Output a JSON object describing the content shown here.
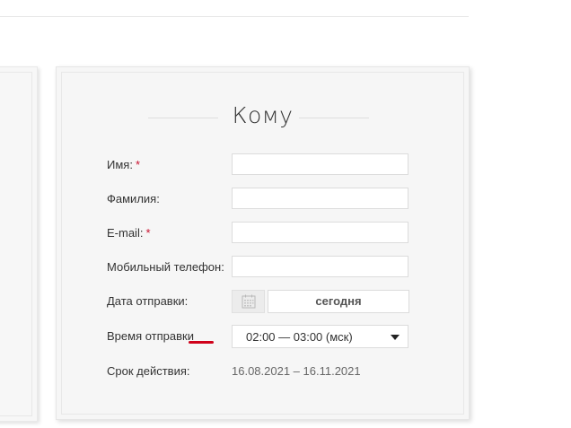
{
  "form": {
    "title": "Кому",
    "fields": {
      "first_name": {
        "label": "Имя:",
        "required_mark": "*",
        "value": ""
      },
      "last_name": {
        "label": "Фамилия:",
        "value": ""
      },
      "email": {
        "label": "E-mail:",
        "required_mark": "*",
        "value": ""
      },
      "mobile_phone": {
        "label": "Мобильный телефон:",
        "value": ""
      },
      "send_date": {
        "label": "Дата отправки:",
        "value": "сегодня"
      },
      "send_time": {
        "label": "Время отправки",
        "value": "02:00 — 03:00 (мск)"
      },
      "validity": {
        "label": "Срок действия:",
        "value": "16.08.2021 – 16.11.2021"
      }
    }
  },
  "colors": {
    "required": "#c8102e",
    "annotation_underline": "#d0021b",
    "card_background": "#f6f6f6"
  },
  "icons": {
    "calendar": "calendar-icon",
    "dropdown": "chevron-down-icon"
  }
}
